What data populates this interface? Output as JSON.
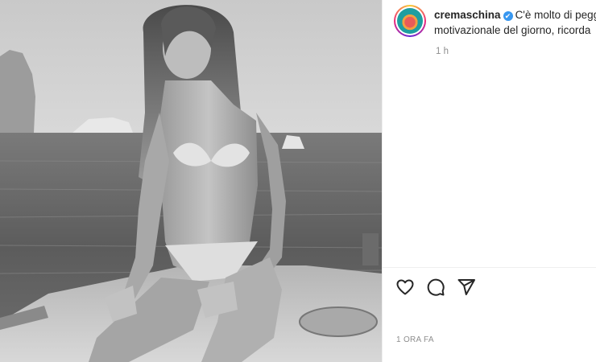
{
  "post": {
    "username": "cremaschina",
    "verified_mark": "✔",
    "caption_line1": "C'è molto di pegg",
    "caption_line2": "motivazionale del giorno, ricorda",
    "time_short": "1 h",
    "time_long": "1 ORA FA"
  },
  "actions": {
    "like_icon": "heart-icon",
    "comment_icon": "comment-icon",
    "share_icon": "share-icon"
  },
  "colors": {
    "accent_verified": "#3897f0",
    "text_primary": "#262626",
    "text_secondary": "#8e8e8e"
  }
}
